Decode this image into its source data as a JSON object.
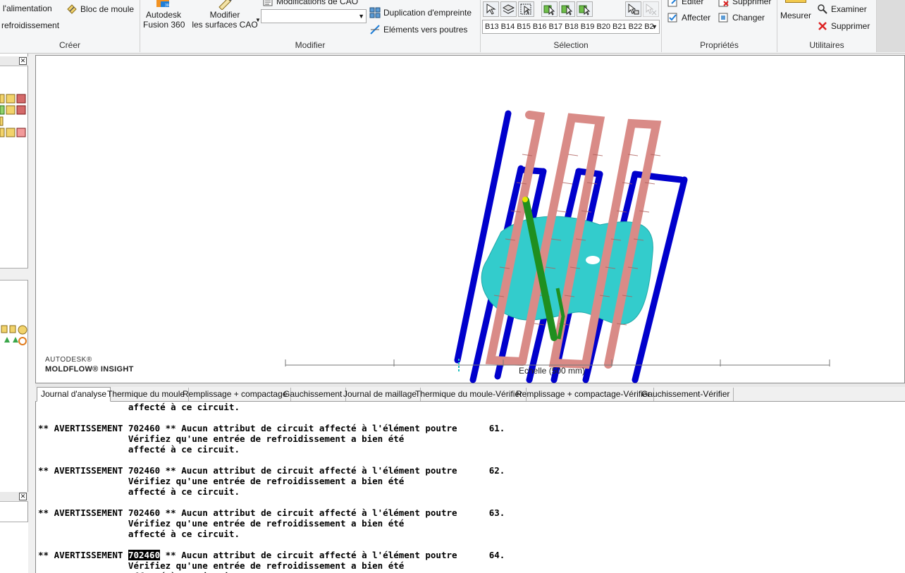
{
  "ribbon": {
    "create": {
      "label": "Créer",
      "items": [
        "l'alimentation",
        "refroidissement",
        "Bloc de moule"
      ]
    },
    "modify": {
      "label": "Modifier",
      "fusion": "Autodesk\nFusion 360",
      "modify_cad": "Modifier\nles surfaces CAO",
      "cad_mods": "Modifications de CAO",
      "dup_imprint": "Duplication d'empreinte",
      "to_beams": "Eléments vers poutres"
    },
    "selection": {
      "label": "Sélection",
      "dropdown_value": "B13 B14 B15 B16 B17 B18 B19 B20 B21 B22 B2"
    },
    "properties": {
      "label": "Propriétés",
      "edit": "Editer",
      "delete_top": "Supprimer",
      "assign": "Affecter",
      "change": "Changer"
    },
    "utilities": {
      "label": "Utilitaires",
      "measure": "Mesurer",
      "examine": "Examiner",
      "delete": "Supprimer"
    }
  },
  "viewport": {
    "brand_top": "AUTODESK®",
    "brand_bottom": "MOLDFLOW® INSIGHT",
    "scale": "Echelle (500 mm)"
  },
  "tabs": [
    "Journal d'analyse",
    "Thermique du moule",
    "Remplissage + compactage",
    "Gauchissement",
    "Journal de maillage",
    "Thermique du moule-Vérifier",
    "Remplissage + compactage-Vérifier",
    "Gauchissement-Vérifier"
  ],
  "log": {
    "lead_line": "                 affecté à ce circuit.",
    "warning_prefix": "** AVERTISSEMENT ",
    "warning_code": "702460",
    "warning_text": " ** Aucun attribut de circuit affecté à l'élément poutre",
    "line2": "                 Vérifiez qu'une entrée de refroidissement a bien été",
    "line3": "                 affecté à ce circuit.",
    "entries": [
      "61.",
      "62.",
      "63.",
      "64."
    ]
  },
  "colors": {
    "blue_channel": "#0000cc",
    "pink_channel": "#d98b87",
    "part": "#33cccc",
    "gate": "#1f8f1f"
  }
}
